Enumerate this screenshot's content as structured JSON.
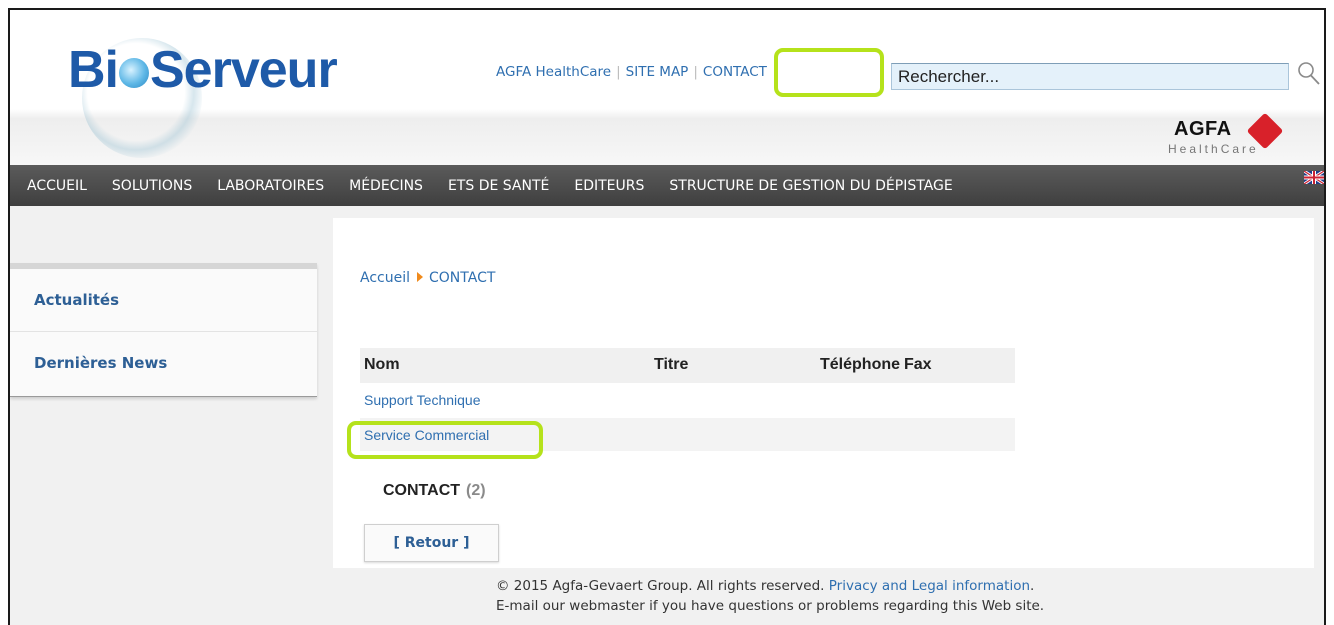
{
  "header": {
    "logo_text": "BioServeur",
    "links": {
      "agfa_healthcare": "AGFA HealthCare",
      "separator": "|",
      "site_map": "SITE MAP",
      "contact": "CONTACT"
    },
    "search": {
      "value": "Rechercher...",
      "icon": "search-icon"
    },
    "brand": {
      "name": "AGFA",
      "sub": "HealthCare"
    }
  },
  "nav": {
    "items": [
      "ACCUEIL",
      "SOLUTIONS",
      "LABORATOIRES",
      "MÉDECINS",
      "ETS DE SANTÉ",
      "EDITEURS",
      "STRUCTURE DE GESTION DU DÉPISTAGE"
    ],
    "flag_icon": "uk-flag-icon"
  },
  "sidebar": {
    "items": [
      {
        "label": "Actualités"
      },
      {
        "label": "Dernières News"
      }
    ]
  },
  "main": {
    "breadcrumb": {
      "home": "Accueil",
      "current": "CONTACT"
    },
    "table": {
      "headers": [
        "Nom",
        "Titre",
        "Téléphone",
        "Fax"
      ],
      "rows": [
        {
          "nom": "Support Technique"
        },
        {
          "nom": "Service Commercial"
        }
      ]
    },
    "contact_label": "CONTACT",
    "contact_count": "(2)",
    "back_button": "[ Retour ]"
  },
  "footer": {
    "line1_text": "© 2015 Agfa-Gevaert Group. All rights reserved.",
    "line1_link": "Privacy and Legal information",
    "line1_end": ".",
    "line2": "E-mail our webmaster if you have questions or problems regarding this Web site."
  },
  "colors": {
    "link": "#2f6fb0",
    "highlight": "#b5e21b",
    "nav_bg": "#4a4a4a",
    "accent_orange": "#f08a1c"
  }
}
